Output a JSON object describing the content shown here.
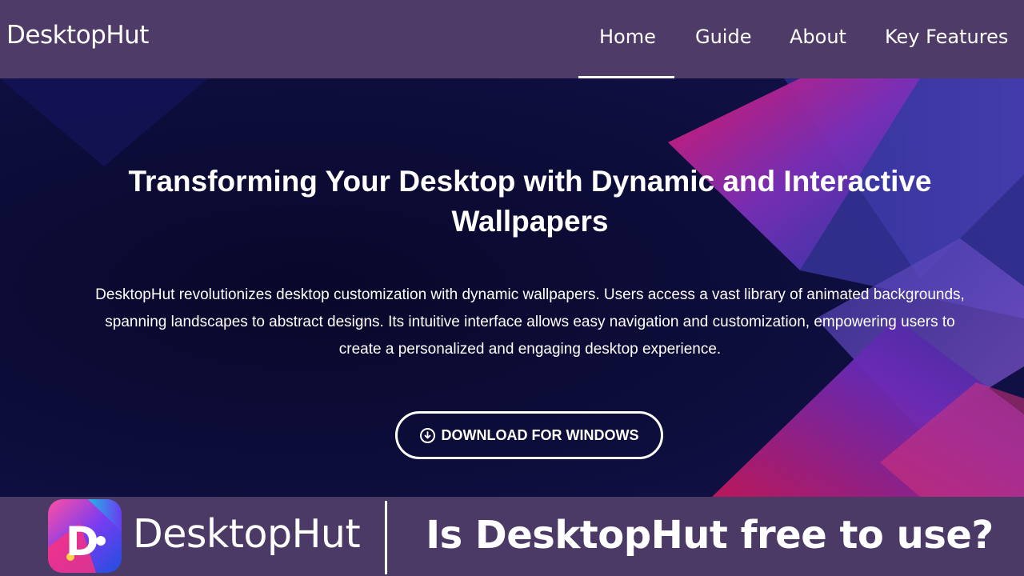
{
  "nav": {
    "brand": "DesktopHut",
    "items": [
      {
        "label": "Home",
        "active": true
      },
      {
        "label": "Guide",
        "active": false
      },
      {
        "label": "About",
        "active": false
      },
      {
        "label": "Key Features",
        "active": false
      }
    ]
  },
  "hero": {
    "title_line1": "Transforming Your Desktop with Dynamic and Interactive",
    "title_line2": "Wallpapers",
    "description_line1": "DesktopHut revolutionizes desktop customization with dynamic wallpapers. Users access a vast library of animated backgrounds,",
    "description_line2": "spanning landscapes to abstract designs. Its intuitive interface allows easy navigation and customization, empowering users to",
    "description_line3": "create a personalized and engaging desktop experience.",
    "download_label": "DOWNLOAD FOR WINDOWS",
    "download_icon": "download-circle-icon"
  },
  "banner": {
    "logo_letter": "D",
    "brand": "DesktopHut",
    "question": "Is DesktopHut free to use?"
  },
  "colors": {
    "nav_bg": "#4e3b68",
    "hero_bg": "#0b0b33",
    "accent_pink": "#d81b78",
    "accent_violet": "#7b3fc4",
    "text": "#ffffff"
  }
}
